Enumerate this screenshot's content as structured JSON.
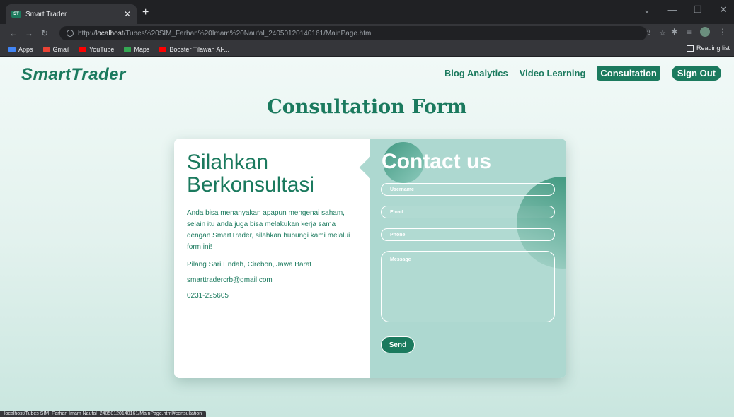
{
  "browser": {
    "tab_title": "Smart Trader",
    "tab_favicon_text": "ST",
    "url_prefix": "http://",
    "url_host": "localhost",
    "url_path": "/Tubes%20SIM_Farhan%20Imam%20Naufal_24050120140161/MainPage.html",
    "bookmarks": [
      "Apps",
      "Gmail",
      "YouTube",
      "Maps",
      "Booster Tilawah Al-..."
    ],
    "bookmark_colors": [
      "#4285f4",
      "#ea4335",
      "#ff0000",
      "#34a853",
      "#ff0000"
    ],
    "reading_list": "Reading list",
    "status_url": "localhost/Tubes SIM_Farhan Imam Naufal_24050120140161/MainPage.html#consultation"
  },
  "navbar": {
    "logo": "SmartTrader",
    "links": [
      "Blog Analytics",
      "Video Learning",
      "Consultation",
      "Sign Out"
    ]
  },
  "main": {
    "title": "Consultation Form",
    "left": {
      "heading": "Silahkan Berkonsultasi",
      "description": "Anda bisa menanyakan apapun mengenai saham, selain itu anda juga bisa melakukan kerja sama dengan SmartTrader, silahkan hubungi kami melalui form ini!",
      "address": "Pilang Sari Endah, Cirebon, Jawa Barat",
      "email": "smarttradercrb@gmail.com",
      "phone": "0231-225605"
    },
    "right": {
      "title": "Contact us",
      "username_placeholder": "Username",
      "email_placeholder": "Email",
      "phone_placeholder": "Phone",
      "message_placeholder": "Message",
      "send_label": "Send"
    }
  },
  "colors": {
    "brand": "#1b7a5e",
    "panel": "#add8d0"
  }
}
